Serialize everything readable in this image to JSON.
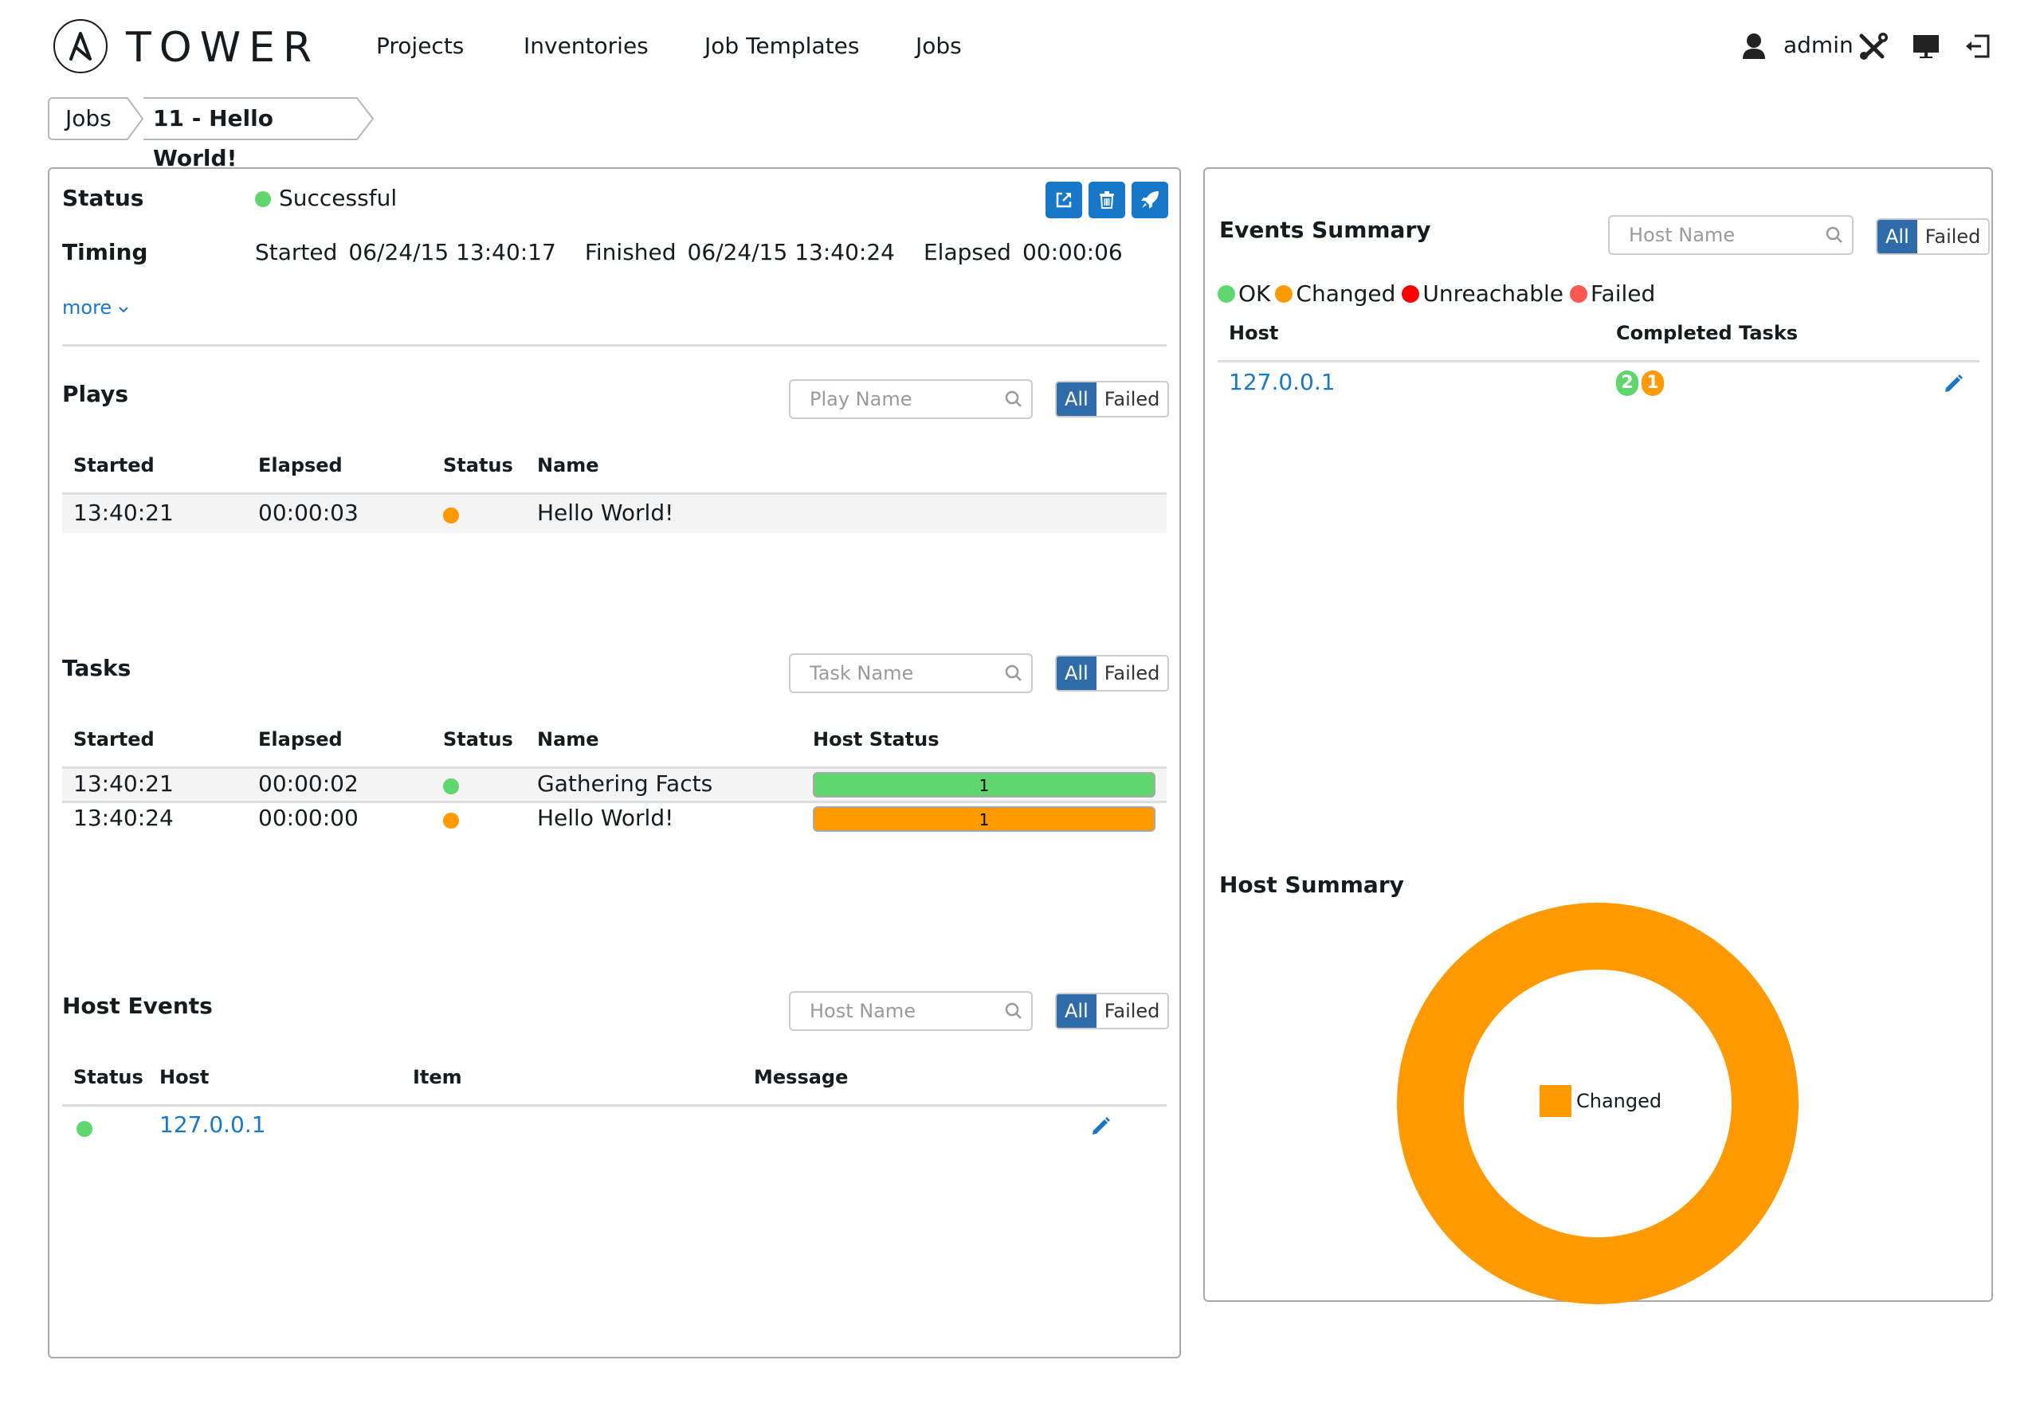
{
  "header": {
    "logo_text": "TOWER",
    "nav": [
      "Projects",
      "Inventories",
      "Job Templates",
      "Jobs"
    ],
    "user": "admin",
    "icons": [
      "user-icon",
      "tools-icon",
      "monitor-icon",
      "logout-icon"
    ]
  },
  "breadcrumb": {
    "items": [
      "Jobs",
      "11 - Hello World!"
    ]
  },
  "job": {
    "status_label": "Status",
    "status_value": "Successful",
    "timing_label": "Timing",
    "started_label": "Started",
    "started_value": "06/24/15 13:40:17",
    "finished_label": "Finished",
    "finished_value": "06/24/15 13:40:24",
    "elapsed_label": "Elapsed",
    "elapsed_value": "00:00:06",
    "more_label": "more",
    "actions": [
      "external-link",
      "delete",
      "relaunch"
    ]
  },
  "colors": {
    "ok": "#60d66f",
    "changed": "#ff9900",
    "unreachable": "#ff0000",
    "failed": "#ff5850",
    "accent": "#1778c9",
    "toggle_active": "#2e6ba8"
  },
  "plays": {
    "title": "Plays",
    "search_placeholder": "Play Name",
    "filter_all": "All",
    "filter_failed": "Failed",
    "columns": [
      "Started",
      "Elapsed",
      "Status",
      "Name"
    ],
    "rows": [
      {
        "started": "13:40:21",
        "elapsed": "00:00:03",
        "status": "changed",
        "name": "Hello World!"
      }
    ]
  },
  "tasks": {
    "title": "Tasks",
    "search_placeholder": "Task Name",
    "filter_all": "All",
    "filter_failed": "Failed",
    "columns": [
      "Started",
      "Elapsed",
      "Status",
      "Name",
      "Host Status"
    ],
    "rows": [
      {
        "started": "13:40:21",
        "elapsed": "00:00:02",
        "status": "ok",
        "name": "Gathering Facts",
        "host_status_count": "1",
        "host_status": "ok"
      },
      {
        "started": "13:40:24",
        "elapsed": "00:00:00",
        "status": "changed",
        "name": "Hello World!",
        "host_status_count": "1",
        "host_status": "changed"
      }
    ]
  },
  "host_events": {
    "title": "Host Events",
    "search_placeholder": "Host Name",
    "filter_all": "All",
    "filter_failed": "Failed",
    "columns": [
      "Status",
      "Host",
      "Item",
      "Message"
    ],
    "rows": [
      {
        "status": "ok",
        "host": "127.0.0.1",
        "item": "",
        "message": ""
      }
    ]
  },
  "events_summary": {
    "title": "Events Summary",
    "search_placeholder": "Host Name",
    "filter_all": "All",
    "filter_failed": "Failed",
    "legend": [
      "OK",
      "Changed",
      "Unreachable",
      "Failed"
    ],
    "columns": [
      "Host",
      "Completed Tasks"
    ],
    "rows": [
      {
        "host": "127.0.0.1",
        "ok_count": "2",
        "changed_count": "1"
      }
    ]
  },
  "host_summary": {
    "title": "Host Summary"
  },
  "chart_data": {
    "type": "pie",
    "title": "Host Summary",
    "donut": true,
    "categories": [
      "Changed"
    ],
    "values": [
      1
    ],
    "colors": [
      "#ff9900"
    ],
    "legend": [
      "Changed"
    ],
    "legend_placement": "center"
  }
}
